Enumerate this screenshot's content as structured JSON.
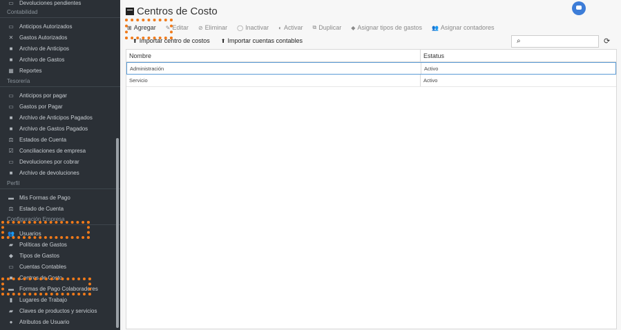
{
  "sidebar": {
    "top_item": "Devoluciones pendientes",
    "sections": [
      {
        "header": "Contabilidad",
        "items": [
          {
            "label": "Anticipos Autorizados",
            "icon": "card-icon"
          },
          {
            "label": "Gastos Autorizados",
            "icon": "wrench-icon"
          },
          {
            "label": "Archivo de Anticipos",
            "icon": "archive-icon"
          },
          {
            "label": "Archivo de Gastos",
            "icon": "archive-icon"
          },
          {
            "label": "Reportes",
            "icon": "grid-icon"
          }
        ]
      },
      {
        "header": "Tesorería",
        "items": [
          {
            "label": "Anticipos por pagar",
            "icon": "card-icon"
          },
          {
            "label": "Gastos por Pagar",
            "icon": "card-icon"
          },
          {
            "label": "Archivo de Anticipos Pagados",
            "icon": "archive-icon"
          },
          {
            "label": "Archivo de Gastos Pagados",
            "icon": "archive-icon"
          },
          {
            "label": "Estados de Cuenta",
            "icon": "scale-icon"
          },
          {
            "label": "Conciliaciones de empresa",
            "icon": "check-icon"
          },
          {
            "label": "Devoluciones por cobrar",
            "icon": "card-icon"
          },
          {
            "label": "Archivo de devoluciones",
            "icon": "archive-icon"
          }
        ]
      },
      {
        "header": "Perfil",
        "items": [
          {
            "label": "Mis Formas de Pago",
            "icon": "credit-card-icon"
          },
          {
            "label": "Estado de Cuenta",
            "icon": "scale-icon"
          }
        ]
      },
      {
        "header": "Configuración Empresa",
        "items": [
          {
            "label": "Usuarios",
            "icon": "users-icon"
          },
          {
            "label": "Políticas de Gastos",
            "icon": "book-icon"
          },
          {
            "label": "Tipos de Gastos",
            "icon": "tag-icon"
          },
          {
            "label": "Cuentas Contables",
            "icon": "card-icon"
          },
          {
            "label": "Centros de Costo",
            "icon": "archive-icon"
          },
          {
            "label": "Formas de Pago Colaboradores",
            "icon": "credit-card-icon"
          },
          {
            "label": "Lugares de Trabajo",
            "icon": "building-icon"
          },
          {
            "label": "Claves de productos y servicios",
            "icon": "briefcase-icon"
          },
          {
            "label": "Atributos de Usuario",
            "icon": "user-icon"
          }
        ]
      }
    ]
  },
  "page": {
    "title": "Centros de Costo",
    "title_icon": "archive-icon"
  },
  "toolbar": {
    "add": "Agregar",
    "edit": "Editar",
    "delete": "Eliminar",
    "deactivate": "Inactivar",
    "activate": "Activar",
    "duplicate": "Duplicar",
    "assign_expense_types": "Asignar tipos de gastos",
    "assign_accountants": "Asignar contadores",
    "import_cost_centers": "Importar centro de costos",
    "import_accounts": "Importar cuentas contables"
  },
  "search": {
    "value": "",
    "placeholder": ""
  },
  "grid": {
    "columns": [
      "Nombre",
      "Estatus"
    ],
    "rows": [
      [
        "Administración",
        "Activo"
      ],
      [
        "Servicio",
        "Activo"
      ]
    ]
  },
  "colors": {
    "highlight": "#f07a1a",
    "sidebar_bg": "#2b3036",
    "accent": "#3d7dd8"
  }
}
